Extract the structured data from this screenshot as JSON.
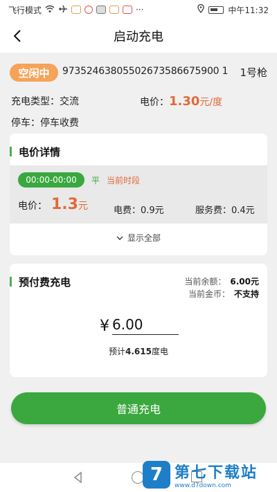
{
  "status_bar": {
    "mode": "飞行模式",
    "time": "中午11:32",
    "more": "···"
  },
  "header": {
    "title": "启动充电"
  },
  "station": {
    "status_badge": "空闲中",
    "serial": "97352463805502673586675900 1",
    "gun": "1号枪",
    "type_label": "充电类型：",
    "type_value": "交流",
    "price_label": "电价：",
    "price_value": "1.30",
    "price_unit": "元/度",
    "parking_label": "停车：",
    "parking_value": "停车收费"
  },
  "price_detail": {
    "title": "电价详情",
    "period": "00:00-00:00",
    "flat": "平",
    "current": "当前时段",
    "price_label": "电价：",
    "price_value": "1.3",
    "price_unit": "元",
    "elec_fee": "电费：0.9元",
    "service_fee": "服务费：0.4元",
    "show_all": "显示全部"
  },
  "prepay": {
    "title": "预付费充电",
    "balance_label": "当前余额：",
    "balance_value": "6.00元",
    "coin_label": "当前金币：",
    "coin_value": "不支持",
    "currency": "¥",
    "amount": "6.00",
    "estimate_prefix": "预计",
    "estimate_value": "4.615",
    "estimate_suffix": "度电"
  },
  "action": {
    "button": "普通充电"
  },
  "watermark": {
    "title": "第七下载站",
    "url": "www.d7down.com",
    "logo_letter": "7"
  },
  "colors": {
    "green": "#3aa83f",
    "orange": "#f6a35a",
    "price_red": "#e06a3a"
  }
}
